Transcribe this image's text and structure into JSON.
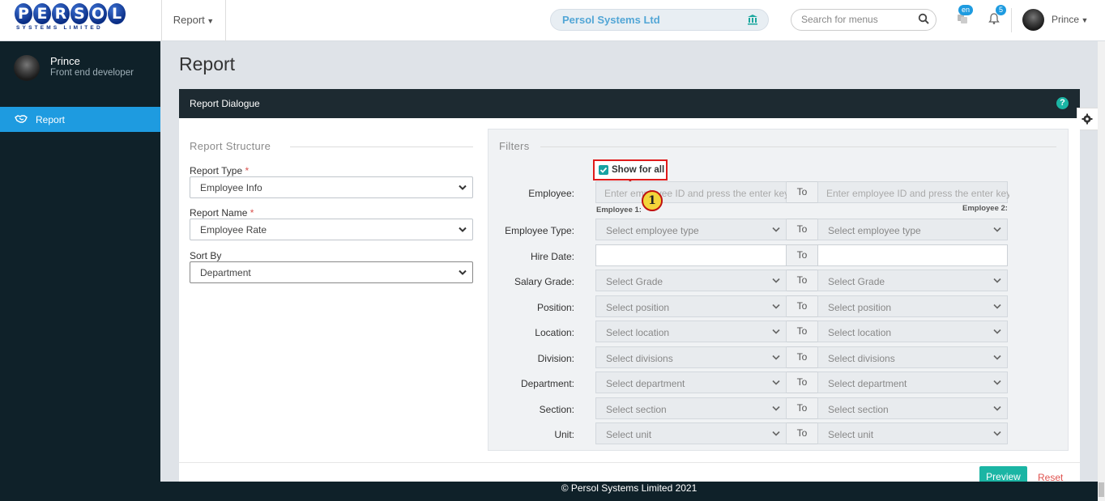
{
  "topbar": {
    "logo_letters": [
      "P",
      "E",
      "R",
      "S",
      "O",
      "L"
    ],
    "logo_sub": "SYSTEMS LIMITED",
    "menu_label": "Report",
    "company": "Persol Systems Ltd",
    "search_placeholder": "Search for menus",
    "lang_badge": "en",
    "notif_count": "5",
    "user_name": "Prince"
  },
  "sidebar": {
    "user_name": "Prince",
    "user_role": "Front end developer",
    "items": [
      {
        "label": "Report",
        "icon": "handshake-icon",
        "active": true
      }
    ]
  },
  "page": {
    "title": "Report"
  },
  "panel": {
    "title": "Report Dialogue",
    "structure": {
      "title": "Report Structure",
      "report_type_label": "Report Type",
      "report_type_value": "Employee Info",
      "report_name_label": "Report Name",
      "report_name_value": "Employee Rate",
      "sort_by_label": "Sort By",
      "sort_by_value": "Department",
      "required_mark": "*"
    },
    "filters": {
      "title": "Filters",
      "show_for_all": "Show for all",
      "show_for_all_checked": true,
      "to_label": "To",
      "employee_label": "Employee:",
      "employee_placeholder": "Enter employee ID and press the enter key",
      "employee1_caption": "Employee 1:",
      "employee2_caption": "Employee 2:",
      "hire_date_label": "Hire Date:",
      "rows": [
        {
          "label": "Employee Type:",
          "placeholder": "Select employee type"
        },
        {
          "label": "Salary Grade:",
          "placeholder": "Select Grade"
        },
        {
          "label": "Position:",
          "placeholder": "Select position"
        },
        {
          "label": "Location:",
          "placeholder": "Select location"
        },
        {
          "label": "Division:",
          "placeholder": "Select divisions"
        },
        {
          "label": "Department:",
          "placeholder": "Select department"
        },
        {
          "label": "Section:",
          "placeholder": "Select section"
        },
        {
          "label": "Unit:",
          "placeholder": "Select unit"
        }
      ]
    },
    "preview_button": "Preview",
    "reset_link": "Reset"
  },
  "callout": "1",
  "footer": "© Persol Systems Limited 2021",
  "colors": {
    "accent": "#1e9be0",
    "teal": "#1bb5a4",
    "sidebar": "#0f2129",
    "highlight": "#e01b1b"
  }
}
